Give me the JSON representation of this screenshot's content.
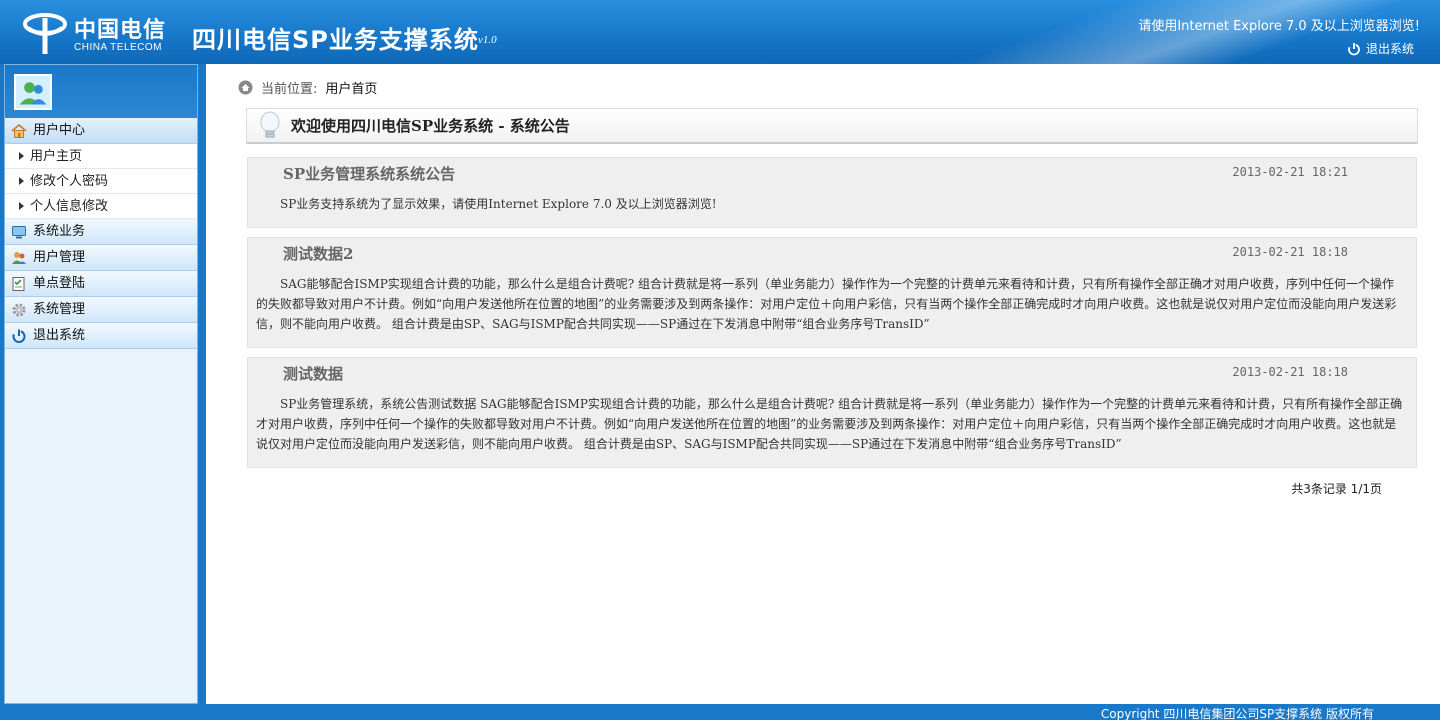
{
  "header": {
    "logo_cn": "中国电信",
    "logo_en": "CHINA TELECOM",
    "title": "四川电信SP业务支撑系统",
    "version": "v1.0",
    "browser_tip": "请使用Internet Explore 7.0 及以上浏览器浏览!",
    "logout_label": "退出系统"
  },
  "sidebar": {
    "menus": [
      {
        "label": "用户中心",
        "icon": "home-icon"
      },
      {
        "label": "系统业务",
        "icon": "monitor-icon"
      },
      {
        "label": "用户管理",
        "icon": "users-icon"
      },
      {
        "label": "单点登陆",
        "icon": "checklist-icon"
      },
      {
        "label": "系统管理",
        "icon": "gear-icon"
      },
      {
        "label": "退出系统",
        "icon": "power-icon"
      }
    ],
    "sub_items": [
      "用户主页",
      "修改个人密码",
      "个人信息修改"
    ]
  },
  "breadcrumb": {
    "prefix": "当前位置:",
    "current": "用户首页"
  },
  "welcome": {
    "title": "欢迎使用四川电信SP业务系统 - 系统公告"
  },
  "notices": [
    {
      "title": "SP业务管理系统系统公告",
      "date": "2013-02-21 18:21",
      "body": "SP业务支持系统为了显示效果，请使用Internet Explore 7.0 及以上浏览器浏览!"
    },
    {
      "title": "测试数据2",
      "date": "2013-02-21 18:18",
      "body": "SAG能够配合ISMP实现组合计费的功能，那么什么是组合计费呢? 组合计费就是将一系列（单业务能力）操作作为一个完整的计费单元来看待和计费，只有所有操作全部正确才对用户收费，序列中任何一个操作的失败都导致对用户不计费。例如“向用户发送他所在位置的地图”的业务需要涉及到两条操作：对用户定位＋向用户彩信，只有当两个操作全部正确完成时才向用户收费。这也就是说仅对用户定位而没能向用户发送彩信，则不能向用户收费。 组合计费是由SP、SAG与ISMP配合共同实现——SP通过在下发消息中附带“组合业务序号TransID”"
    },
    {
      "title": "测试数据",
      "date": "2013-02-21 18:18",
      "body": "SP业务管理系统，系统公告测试数据 SAG能够配合ISMP实现组合计费的功能，那么什么是组合计费呢? 组合计费就是将一系列（单业务能力）操作作为一个完整的计费单元来看待和计费，只有所有操作全部正确才对用户收费，序列中任何一个操作的失败都导致对用户不计费。例如“向用户发送他所在位置的地图”的业务需要涉及到两条操作：对用户定位＋向用户彩信，只有当两个操作全部正确完成时才向用户收费。这也就是说仅对用户定位而没能向用户发送彩信，则不能向用户收费。 组合计费是由SP、SAG与ISMP配合共同实现——SP通过在下发消息中附带“组合业务序号TransID”"
    }
  ],
  "pager": {
    "text": "共3条记录 1/1页"
  },
  "footer": {
    "copyright": "Copyright  四川电信集团公司SP支撑系统 版权所有"
  },
  "colors": {
    "brand_blue": "#1a78c8",
    "sidebar_bg": "#e8f3fc",
    "notice_bg": "#efefef"
  }
}
